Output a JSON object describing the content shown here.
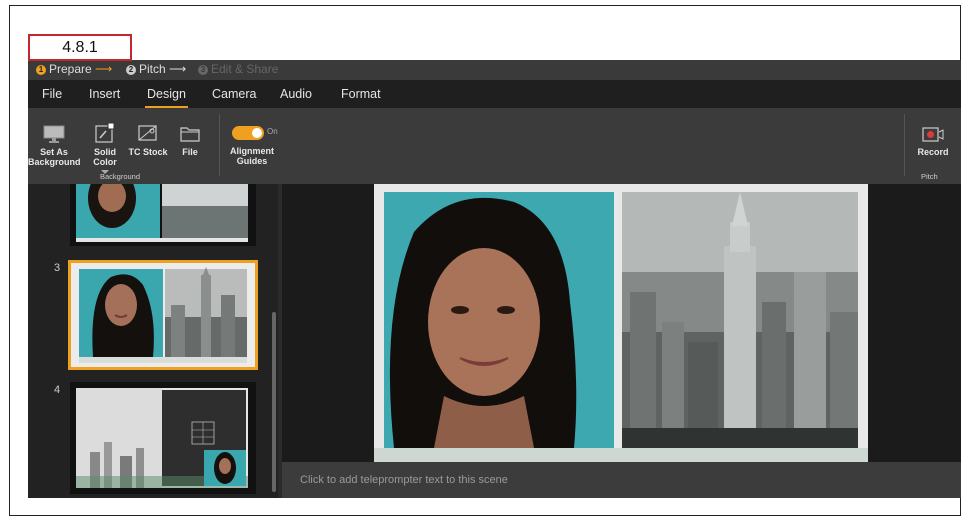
{
  "figure_label": "4.8.1",
  "workflow": {
    "steps": [
      {
        "num": "1",
        "label": "Prepare",
        "arrow": "⟶"
      },
      {
        "num": "2",
        "label": "Pitch",
        "arrow": "⟶"
      },
      {
        "num": "3",
        "label": "Edit & Share"
      }
    ]
  },
  "menu": [
    "File",
    "Insert",
    "Design",
    "Camera",
    "Audio",
    "Format"
  ],
  "active_menu": "Design",
  "ribbon": {
    "set_as_background": [
      "Set As",
      "Background"
    ],
    "solid_color": "Solid Color",
    "tc_stock": "TC Stock",
    "file": "File",
    "background_group": "Background",
    "toggle_state": "On",
    "alignment_guides": [
      "Alignment",
      "Guides"
    ],
    "record": "Record",
    "pitch_group": "Pitch"
  },
  "slides": [
    {
      "number": ""
    },
    {
      "number": "3",
      "selected": true
    },
    {
      "number": "4"
    }
  ],
  "teleprompter_placeholder": "Click to add teleprompter text to this scene",
  "colors": {
    "accent": "#f0a020",
    "teal": "#3aa6ae",
    "record_red": "#d93a3a"
  }
}
